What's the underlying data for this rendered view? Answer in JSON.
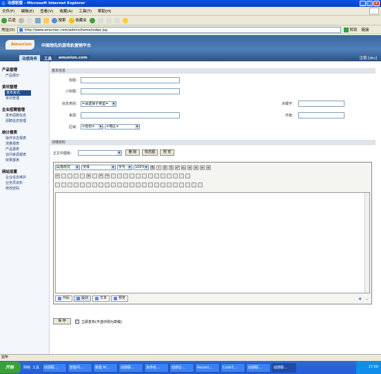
{
  "window": {
    "title": "动感联盟 - Microsoft Internet Explorer"
  },
  "menu": [
    "文件(F)",
    "编辑(E)",
    "查看(V)",
    "收藏(A)",
    "工具(T)",
    "帮助(H)"
  ],
  "toolbar": {
    "back": "后退",
    "search": "搜索",
    "favorites": "收藏夹"
  },
  "address": {
    "label": "地址(D)",
    "url": "http://www.amunion.com/admin/home/index.jsp",
    "go": "转到",
    "links": "链接"
  },
  "banner": {
    "logo": "Amunion",
    "slogan": "中国领先的游戏机营销平台",
    "tabs": [
      "动感商务",
      "工具",
      "amunion.com"
    ],
    "user": "注销 [diu]"
  },
  "sidebar": [
    {
      "title": "产品管理",
      "items": [
        "产品报价"
      ]
    },
    {
      "title": "资讯管理",
      "items": [
        "发布资讯",
        "资讯管理"
      ]
    },
    {
      "title": "企业招聘管理",
      "items": [
        "发布招聘信息",
        "招聘信息管理"
      ]
    },
    {
      "title": "统计报表",
      "items": [
        "操作日志报表",
        "流量报表",
        "产品报表",
        "访问来源报表",
        "效果报表"
      ]
    },
    {
      "title": "网站设置",
      "items": [
        "企业信息维护",
        "业务员资料",
        "修改密码"
      ]
    }
  ],
  "form": {
    "section_basic": "基本信息",
    "title_label": "标题：",
    "subtitle_label": "小标题：",
    "category_label": "信息类别：",
    "category_value": "=请选择子类型=",
    "keyword_label": "关键字：",
    "source_label": "来源：",
    "author_label": "作者：",
    "region_label": "区域：",
    "province_value": "=省份=",
    "city_value": "=地区=",
    "section_detail": "详细资料",
    "image_label": "正文中图像：",
    "delete_btn": "删 除",
    "logo_btn": "标志图",
    "preview_btn": "预 览",
    "editor": {
      "style": "段落样式",
      "font": "字体",
      "size": "字号",
      "zoom": "100%",
      "modes": [
        "代码",
        "设计",
        "文本",
        "预览"
      ]
    },
    "save_btn": "保 存",
    "publish_label": "立即发布(不选中则为草稿)"
  },
  "statusbar": "完毕",
  "taskbar": {
    "start": "开始",
    "quick": [
      "网络",
      "工具"
    ],
    "tasks": [
      "动感联...",
      "智能问...",
      "新建 M...",
      "动感联...",
      "未命名...",
      "动感企...",
      "Recent...",
      "CodeT...",
      "动感联...",
      "Microso...",
      "动感联..."
    ],
    "clock": "17:00"
  },
  "colors": {
    "accent": "#1f4f8f",
    "banner": "#3a66a0",
    "xp_blue": "#245dda"
  }
}
